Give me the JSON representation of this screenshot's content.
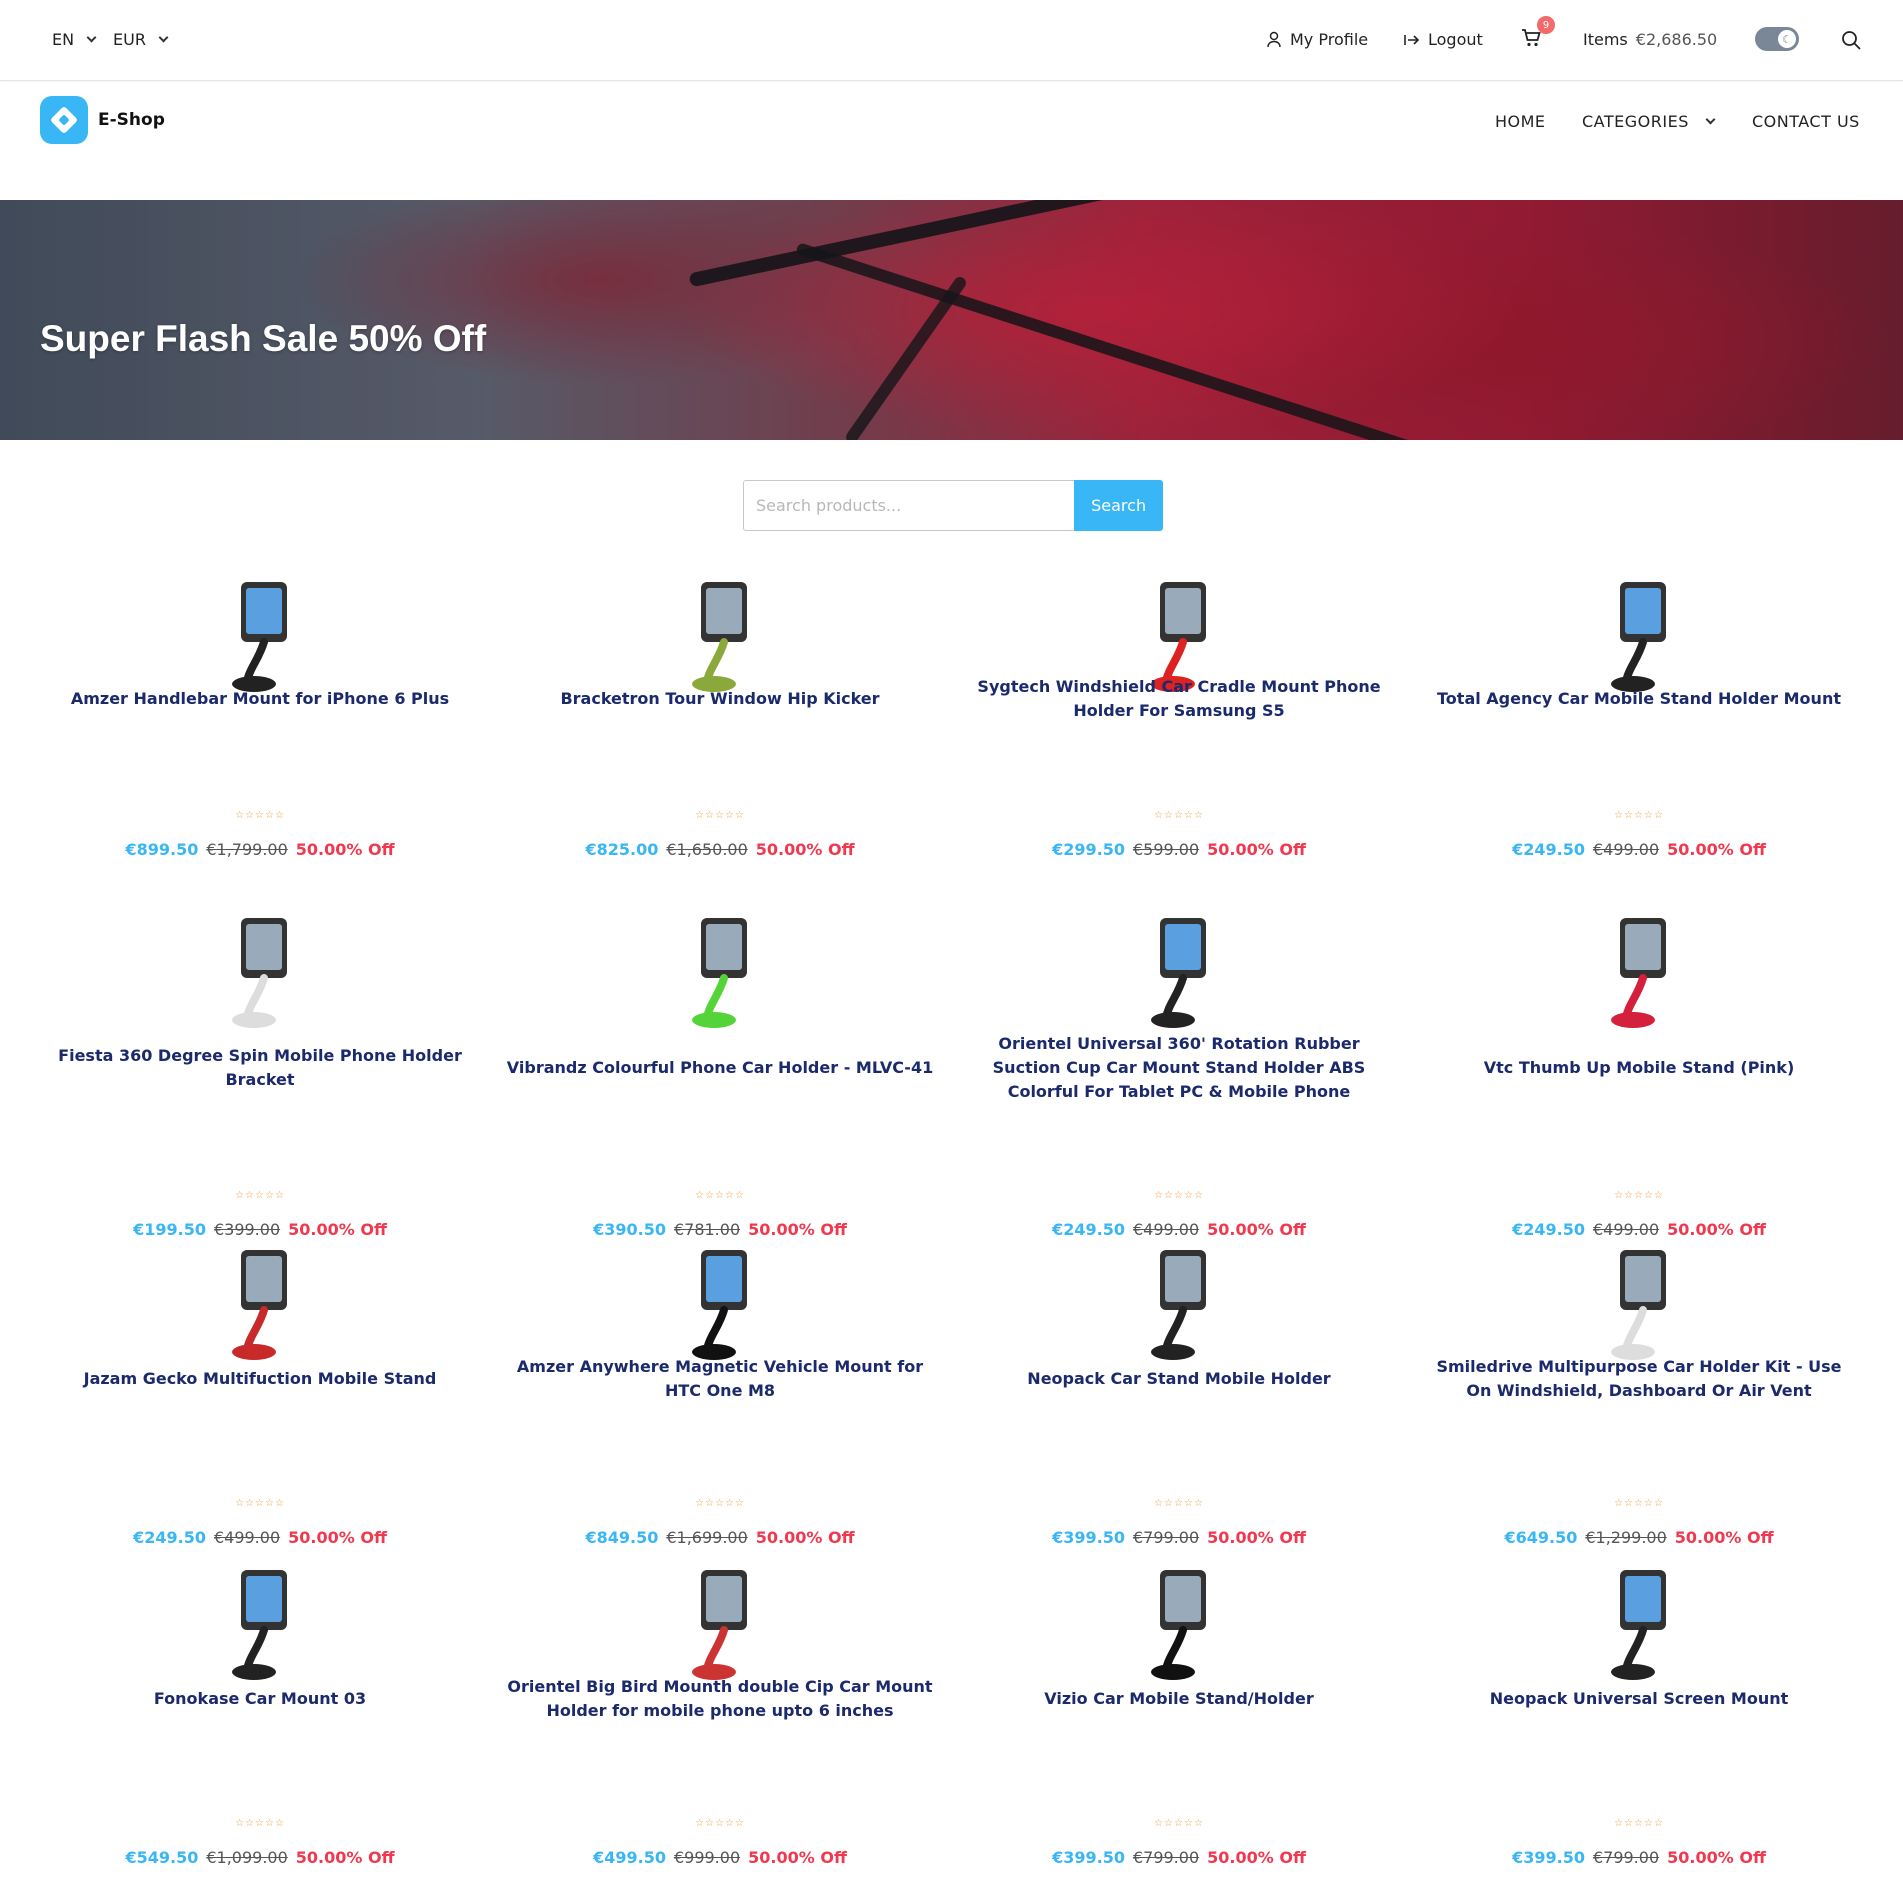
{
  "topbar": {
    "language": "EN",
    "currency": "EUR",
    "profile_label": "My Profile",
    "logout_label": "Logout",
    "cart_count": "9",
    "items_label": "Items",
    "items_total": "€2,686.50"
  },
  "brand": {
    "name": "E-Shop",
    "accent": "#38b6f5"
  },
  "nav": {
    "home": "HOME",
    "categories": "CATEGORIES",
    "contact": "CONTACT US"
  },
  "hero": {
    "title": "Super Flash Sale 50% Off"
  },
  "search": {
    "placeholder": "Search products...",
    "button": "Search"
  },
  "products": [
    {
      "title": "Amzer Handlebar Mount for iPhone 6 Plus",
      "rating": "☆☆☆☆☆",
      "price": "€899.50",
      "old_price": "€1,799.00",
      "discount": "50.00% Off"
    },
    {
      "title": "Bracketron Tour Window Hip Kicker",
      "rating": "☆☆☆☆☆",
      "price": "€825.00",
      "old_price": "€1,650.00",
      "discount": "50.00% Off"
    },
    {
      "title": "Sygtech Windshield Car Cradle Mount Phone Holder For Samsung S5",
      "rating": "☆☆☆☆☆",
      "price": "€299.50",
      "old_price": "€599.00",
      "discount": "50.00% Off"
    },
    {
      "title": "Total Agency Car Mobile Stand Holder Mount",
      "rating": "☆☆☆☆☆",
      "price": "€249.50",
      "old_price": "€499.00",
      "discount": "50.00% Off"
    },
    {
      "title": "Fiesta 360 Degree Spin Mobile Phone Holder Bracket",
      "rating": "☆☆☆☆☆",
      "price": "€199.50",
      "old_price": "€399.00",
      "discount": "50.00% Off"
    },
    {
      "title": "Vibrandz Colourful Phone Car Holder - MLVC-41",
      "rating": "☆☆☆☆☆",
      "price": "€390.50",
      "old_price": "€781.00",
      "discount": "50.00% Off"
    },
    {
      "title": "Orientel Universal 360' Rotation Rubber Suction Cup Car Mount Stand Holder ABS Colorful For Tablet PC & Mobile Phone",
      "rating": "☆☆☆☆☆",
      "price": "€249.50",
      "old_price": "€499.00",
      "discount": "50.00% Off"
    },
    {
      "title": "Vtc Thumb Up Mobile Stand (Pink)",
      "rating": "☆☆☆☆☆",
      "price": "€249.50",
      "old_price": "€499.00",
      "discount": "50.00% Off"
    },
    {
      "title": "Jazam Gecko Multifuction Mobile Stand",
      "rating": "☆☆☆☆☆",
      "price": "€249.50",
      "old_price": "€499.00",
      "discount": "50.00% Off"
    },
    {
      "title": "Amzer Anywhere Magnetic Vehicle Mount for HTC One M8",
      "rating": "☆☆☆☆☆",
      "price": "€849.50",
      "old_price": "€1,699.00",
      "discount": "50.00% Off"
    },
    {
      "title": "Neopack Car Stand Mobile Holder",
      "rating": "☆☆☆☆☆",
      "price": "€399.50",
      "old_price": "€799.00",
      "discount": "50.00% Off"
    },
    {
      "title": "Smiledrive Multipurpose Car Holder Kit - Use On Windshield, Dashboard Or Air Vent",
      "rating": "☆☆☆☆☆",
      "price": "€649.50",
      "old_price": "€1,299.00",
      "discount": "50.00% Off"
    },
    {
      "title": "Fonokase Car Mount 03",
      "rating": "☆☆☆☆☆",
      "price": "€549.50",
      "old_price": "€1,099.00",
      "discount": "50.00% Off"
    },
    {
      "title": "Orientel Big Bird Mounth double Cip Car Mount Holder for mobile phone upto 6 inches",
      "rating": "☆☆☆☆☆",
      "price": "€499.50",
      "old_price": "€999.00",
      "discount": "50.00% Off"
    },
    {
      "title": "Vizio Car Mobile Stand/Holder",
      "rating": "☆☆☆☆☆",
      "price": "€399.50",
      "old_price": "€799.00",
      "discount": "50.00% Off"
    },
    {
      "title": "Neopack Universal Screen Mount",
      "rating": "☆☆☆☆☆",
      "price": "€399.50",
      "old_price": "€799.00",
      "discount": "50.00% Off"
    }
  ]
}
